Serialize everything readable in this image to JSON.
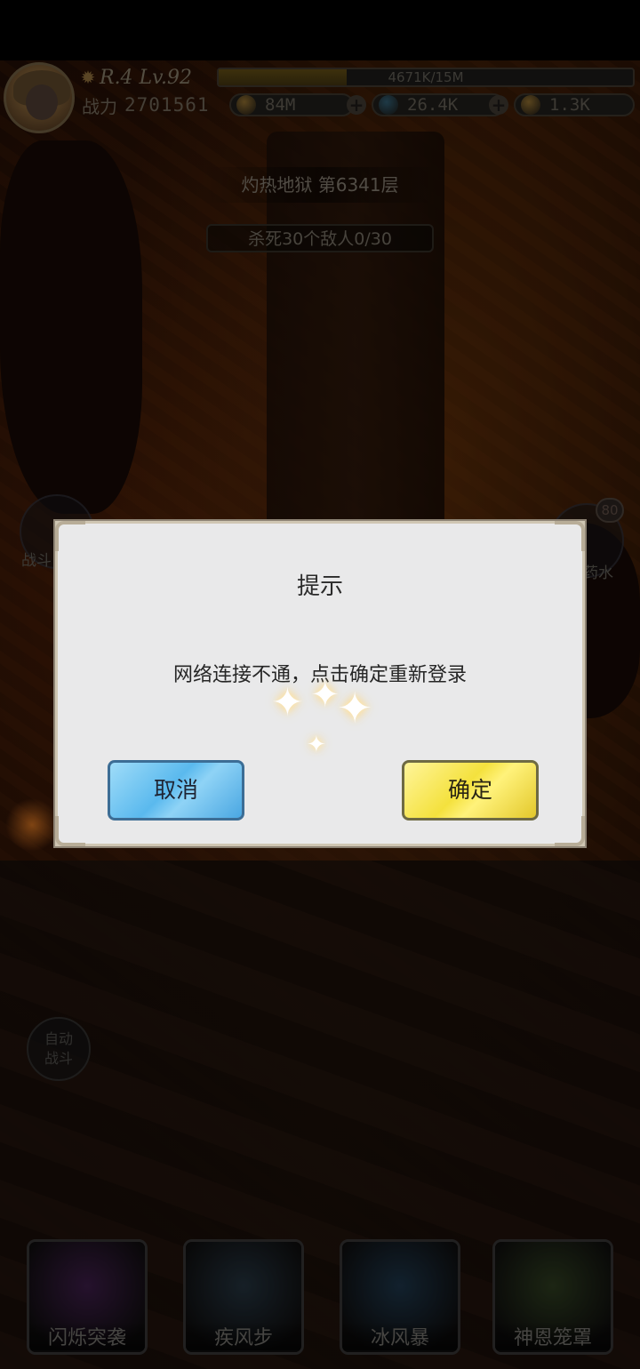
{
  "hud": {
    "rank_level": "R.4 Lv.92",
    "exp_text": "4671K/15M",
    "exp_fraction": 0.31,
    "power_label": "战力",
    "power_value": "2701561",
    "currencies": [
      {
        "icon": "gold-coin-icon",
        "value": "84M",
        "color": "#8a6a2e"
      },
      {
        "icon": "blue-gem-icon",
        "value": "26.4K",
        "color": "#2f5a6e"
      },
      {
        "icon": "amber-crystal-icon",
        "value": "1.3K",
        "color": "#8a6a2e"
      }
    ]
  },
  "stage": {
    "title": "灼热地狱  第6341层",
    "quest": "杀死30个敌人0/30"
  },
  "side": {
    "left_label": "战斗",
    "right_label": "药水",
    "right_badge": "80",
    "auto_battle": "自动\n战斗"
  },
  "skills": [
    {
      "name": "闪烁突袭",
      "icon": "shadow-strike-icon",
      "color": "#3a1c45"
    },
    {
      "name": "疾风步",
      "icon": "swift-wind-icon",
      "color": "#23313c"
    },
    {
      "name": "冰风暴",
      "icon": "ice-storm-icon",
      "color": "#1c3346"
    },
    {
      "name": "神恩笼罩",
      "icon": "divine-grace-icon",
      "color": "#2c3a1f"
    }
  ],
  "dialog": {
    "title": "提示",
    "message": "网络连接不通，点击确定重新登录",
    "cancel_label": "取消",
    "confirm_label": "确定"
  }
}
